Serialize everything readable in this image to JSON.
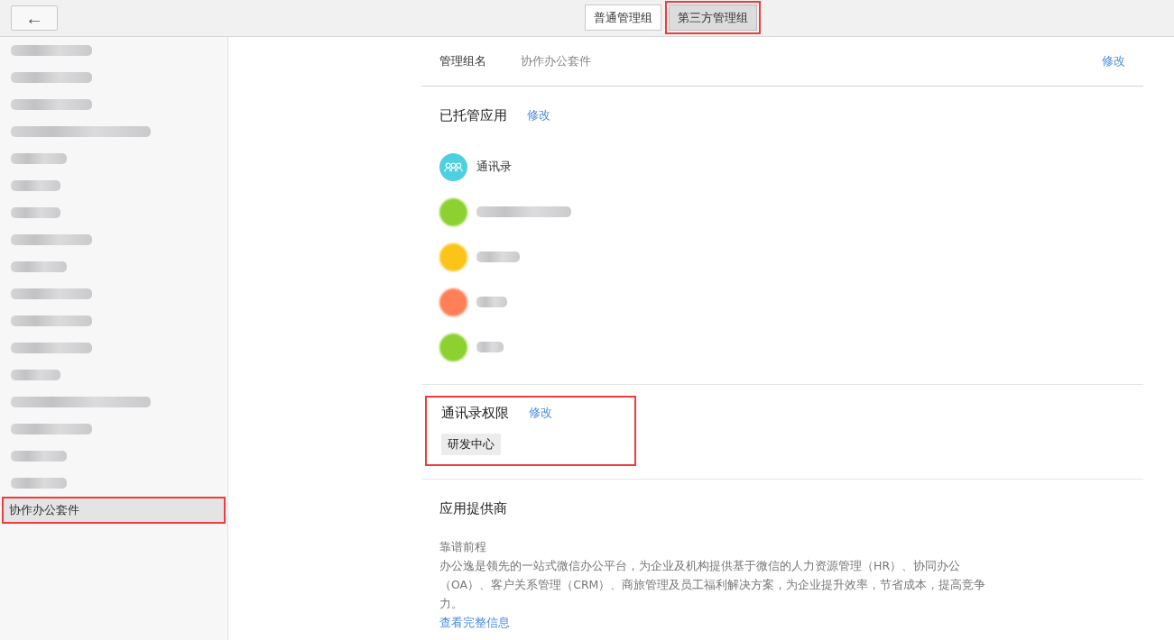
{
  "toolbar": {
    "back_button": "←"
  },
  "tabs": [
    {
      "label": "普通管理组",
      "selected": false,
      "highlighted": false
    },
    {
      "label": "第三方管理组",
      "selected": true,
      "highlighted": true
    }
  ],
  "sidebar": {
    "items": [
      {
        "kind": "redacted",
        "selected": false,
        "highlighted": false
      },
      {
        "kind": "redacted",
        "selected": false,
        "highlighted": false
      },
      {
        "kind": "redacted",
        "selected": false,
        "highlighted": false
      },
      {
        "kind": "redacted",
        "selected": false,
        "highlighted": false
      },
      {
        "kind": "redacted",
        "selected": false,
        "highlighted": false
      },
      {
        "kind": "redacted",
        "selected": false,
        "highlighted": false
      },
      {
        "kind": "redacted",
        "selected": false,
        "highlighted": false
      },
      {
        "kind": "redacted",
        "selected": false,
        "highlighted": false
      },
      {
        "kind": "redacted",
        "selected": false,
        "highlighted": false
      },
      {
        "kind": "redacted",
        "selected": false,
        "highlighted": false
      },
      {
        "kind": "redacted",
        "selected": false,
        "highlighted": false
      },
      {
        "kind": "redacted",
        "selected": false,
        "highlighted": false
      },
      {
        "kind": "redacted",
        "selected": false,
        "highlighted": false
      },
      {
        "kind": "redacted",
        "selected": false,
        "highlighted": false
      },
      {
        "kind": "redacted",
        "selected": false,
        "highlighted": false
      },
      {
        "kind": "redacted",
        "selected": false,
        "highlighted": false
      },
      {
        "kind": "redacted",
        "selected": false,
        "highlighted": false
      },
      {
        "kind": "text",
        "label": "协作办公套件",
        "selected": true,
        "highlighted": true
      }
    ]
  },
  "group_name": {
    "label": "管理组名",
    "value": "协作办公套件",
    "edit": "修改"
  },
  "hosted_apps": {
    "title": "已托管应用",
    "edit": "修改",
    "apps": [
      {
        "kind": "text",
        "name": "通讯录",
        "color": "#4dd0e1"
      },
      {
        "kind": "redacted",
        "color": "#8cd12f"
      },
      {
        "kind": "redacted",
        "color": "#fcc419"
      },
      {
        "kind": "redacted",
        "color": "#ff7f59"
      },
      {
        "kind": "redacted",
        "color": "#8cd12f"
      }
    ]
  },
  "contact_permissions": {
    "title": "通讯录权限",
    "edit": "修改",
    "tags": [
      "研发中心"
    ],
    "highlighted": true
  },
  "provider": {
    "title": "应用提供商",
    "name": "靠谱前程",
    "description": "办公逸是领先的一站式微信办公平台，为企业及机构提供基于微信的人力资源管理（HR）、协同办公（OA）、客户关系管理（CRM）、商旅管理及员工福利解决方案，为企业提升效率，节省成本，提高竞争力。",
    "link": "查看完整信息"
  }
}
